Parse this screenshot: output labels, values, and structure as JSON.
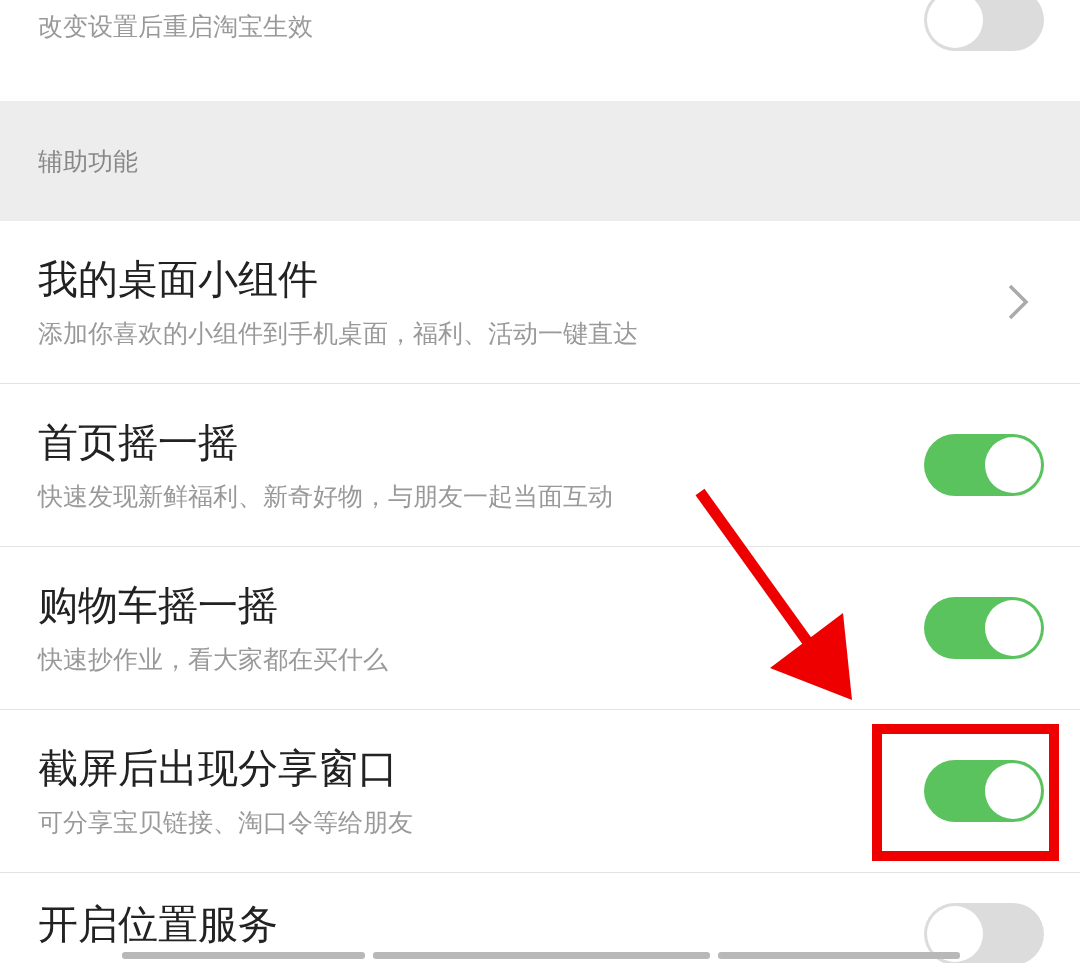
{
  "rows_before": [
    {
      "kind": "toggle",
      "subtitle": "改变设置后重启淘宝生效",
      "on": false
    }
  ],
  "section": {
    "title": "辅助功能"
  },
  "rows": [
    {
      "kind": "link",
      "title": "我的桌面小组件",
      "subtitle": "添加你喜欢的小组件到手机桌面，福利、活动一键直达"
    },
    {
      "kind": "toggle",
      "title": "首页摇一摇",
      "subtitle": "快速发现新鲜福利、新奇好物，与朋友一起当面互动",
      "on": true
    },
    {
      "kind": "toggle",
      "title": "购物车摇一摇",
      "subtitle": "快速抄作业，看大家都在买什么",
      "on": true
    },
    {
      "kind": "toggle",
      "title": "截屏后出现分享窗口",
      "subtitle": "可分享宝贝链接、淘口令等给朋友",
      "on": true
    },
    {
      "kind": "toggle",
      "title": "开启位置服务",
      "on": false
    }
  ]
}
